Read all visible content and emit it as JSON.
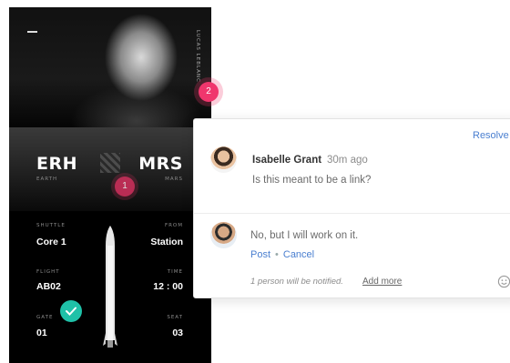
{
  "phone": {
    "photo_credit": "LUCAS LEBLANC",
    "origin": {
      "code": "ERH",
      "name": "EARTH"
    },
    "destination": {
      "code": "MRS",
      "name": "MARS"
    },
    "fields": [
      {
        "label": "SHUTTLE",
        "value": "Core 1"
      },
      {
        "label": "FROM",
        "value": "Station"
      },
      {
        "label": "FLIGHT",
        "value": "AB02"
      },
      {
        "label": "TIME",
        "value": "12 : 00"
      },
      {
        "label": "GATE",
        "value": "01"
      },
      {
        "label": "SEAT",
        "value": "03"
      }
    ]
  },
  "markers": [
    {
      "number": "1"
    },
    {
      "number": "2"
    }
  ],
  "comment": {
    "resolve_label": "Resolve",
    "author": "Isabelle Grant",
    "time": "30m ago",
    "text": "Is this meant to be a link?",
    "reply_text": "No, but I will work on it.",
    "post_label": "Post",
    "separator": "•",
    "cancel_label": "Cancel",
    "notify_text": "1 person will be notified.",
    "add_more_label": "Add more"
  },
  "colors": {
    "marker_pink": "#f0366d",
    "check_teal": "#1fc1a8",
    "link_blue": "#4a7fd0"
  }
}
